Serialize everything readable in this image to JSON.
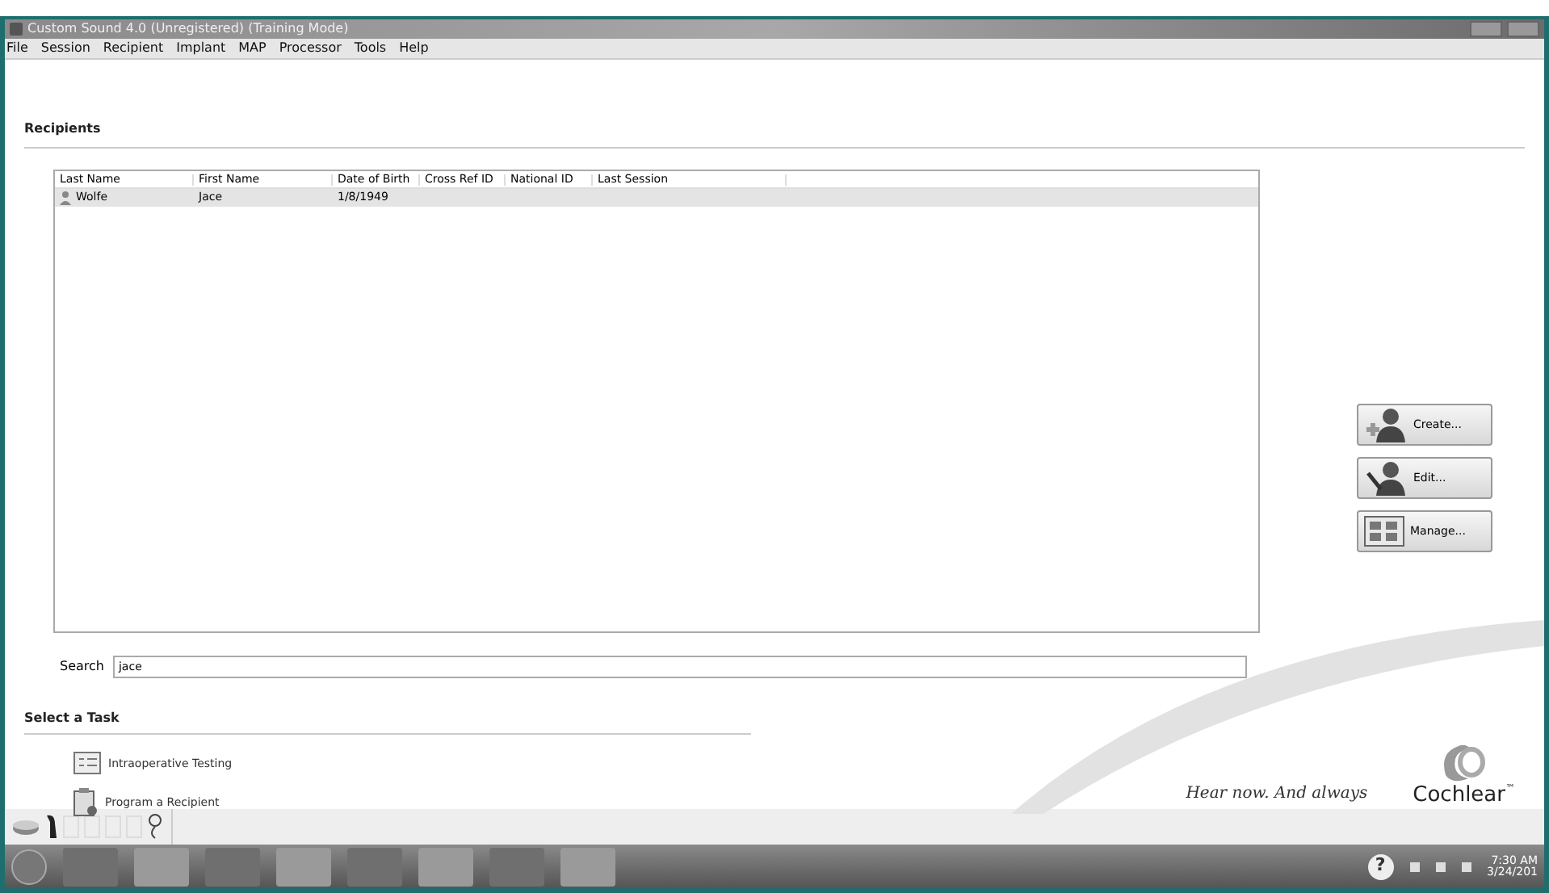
{
  "window": {
    "title": "Custom Sound 4.0 (Unregistered) (Training Mode)"
  },
  "menu": [
    "File",
    "Session",
    "Recipient",
    "Implant",
    "MAP",
    "Processor",
    "Tools",
    "Help"
  ],
  "recipients": {
    "heading": "Recipients",
    "columns": [
      "Last Name",
      "First Name",
      "Date of Birth",
      "Cross Ref ID",
      "National ID",
      "Last Session"
    ],
    "rows": [
      {
        "cells": [
          "Wolfe",
          "Jace",
          "1/8/1949",
          "",
          "",
          ""
        ],
        "selected": true
      }
    ]
  },
  "actions": [
    {
      "label": "Create...",
      "kind": "create"
    },
    {
      "label": "Edit...",
      "kind": "edit"
    },
    {
      "label": "Manage...",
      "kind": "manage"
    }
  ],
  "search": {
    "label": "Search",
    "value": "jace"
  },
  "tasks": {
    "heading": "Select a Task",
    "items": [
      {
        "label": "Intraoperative Testing",
        "kind": "testing"
      },
      {
        "label": "Program a Recipient",
        "kind": "program"
      }
    ]
  },
  "brand": {
    "slogan": "Hear now. And always",
    "name": "Cochlear",
    "mark": "™"
  },
  "taskbar": {
    "help": "?",
    "time": "7:30 AM",
    "date": "3/24/201"
  }
}
